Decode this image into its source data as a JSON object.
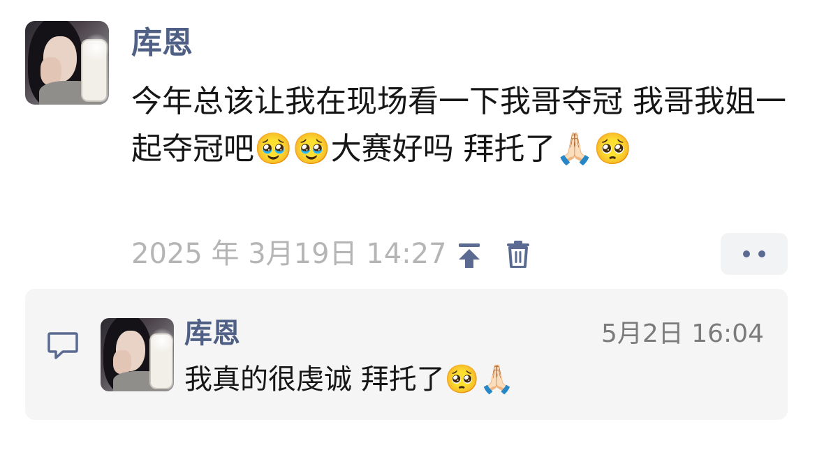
{
  "post": {
    "username": "库恩",
    "text": "今年总该让我在现场看一下我哥夺冠 我哥我姐一起夺冠吧🥹🥹大赛好吗 拜托了🙏🏻🥺",
    "timestamp": "2025 年 3月19日 14:27",
    "avatar_icon": "user-avatar-photo",
    "actions": {
      "pin_icon": "pin-top-icon",
      "delete_icon": "trash-icon",
      "more_icon": "more-dots-icon"
    }
  },
  "reply": {
    "username": "库恩",
    "time": "5月2日 16:04",
    "text": "我真的很虔诚 拜托了🥺🙏🏻",
    "comment_icon": "comment-bubble-icon",
    "avatar_icon": "user-avatar-photo"
  },
  "colors": {
    "username": "#4f5f85",
    "icon": "#5a6a90",
    "timestamp": "#b5b5b5",
    "reply_bg": "#f5f5f5"
  }
}
